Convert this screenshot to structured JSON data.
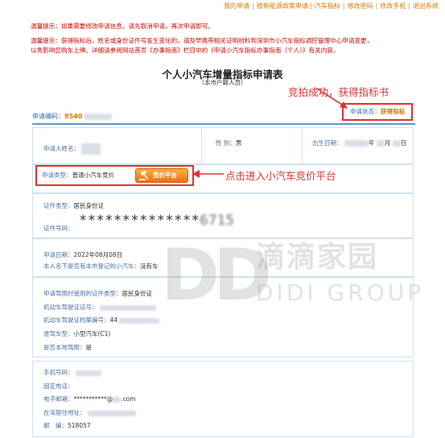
{
  "topnav": {
    "items": [
      "我的申请",
      "按新能源政策申请小汽车指标",
      "修改密码",
      "修改手机",
      "退出系统"
    ]
  },
  "notices": {
    "line1": "温馨提示：如果需要修改申请信息，请先取消申请，再次申请即可。",
    "line2": "温馨提示：获得指标后，姓名或身份证件号发生变化的，请及早携带相关证明材料到深圳市小汽车指标调控管理中心申请变更，",
    "line3": "以免影响您购车上牌。详细请参阅网站首页《办事指南》栏目中的《申请小汽车指标办事指南（个人）》有关内容。"
  },
  "title": "个人小汽车增量指标申请表",
  "subtitle": "（本市户籍人员）",
  "annotations": {
    "status_note": "竞拍成功，获得指标书",
    "platform_note": "点击进入小汽车竞价平台"
  },
  "application": {
    "number_label": "申请编码：",
    "number_value": "9540",
    "status_label": "申请状态：",
    "status_value": "获得指标"
  },
  "applicant": {
    "name_label": "申请人姓名：",
    "gender_label": "性 别：",
    "gender_value": "男",
    "birth_label": "出生日期：",
    "birth_year_suffix": "年",
    "birth_month_suffix": "月",
    "birth_day_suffix": "日"
  },
  "apptype": {
    "label": "申请类型：",
    "value": "普通小汽车竞价",
    "button_label": "竞价平台"
  },
  "certificate": {
    "type_label": "证件类型：",
    "type_value": "居民身份证",
    "number_label": "证件号码：",
    "number_value": "**************",
    "number_tail": "6715"
  },
  "apply_info": {
    "date_label": "申请日期：",
    "date_value": "2022年08月08日",
    "car_label": "本人名下是否有本市登记的小汽车：",
    "car_value": "没有车"
  },
  "license": {
    "cert_type_label": "申请驾照时使用的证件类型：",
    "cert_type_value": "居民身份证",
    "license_no_label": "机动车驾驶证证号：",
    "file_no_label": "机动车驾驶证档案编号：",
    "file_no_value": "44",
    "class_label": "准驾车型：",
    "class_value": "小型汽车(C1)",
    "local_label": "是否本地驾照：",
    "local_value": "是"
  },
  "contact": {
    "mobile_label": "手机号码：",
    "phone_label": "固定电话：",
    "email_label": "电子邮箱：",
    "email_value_prefix": "***********@",
    "email_value_suffix": ".com",
    "address_label": "在深居住地址：",
    "postcode_label": "邮　编：",
    "postcode_value": "518057"
  },
  "watermark": {
    "logo": "DD",
    "cn": "滴滴家园",
    "en": "DIDI GROUP"
  },
  "colors": {
    "accent_orange": "#d67a00",
    "alert_red": "#e03030",
    "label_blue": "#4a6fa0",
    "rule_blue": "#5a96cf"
  }
}
